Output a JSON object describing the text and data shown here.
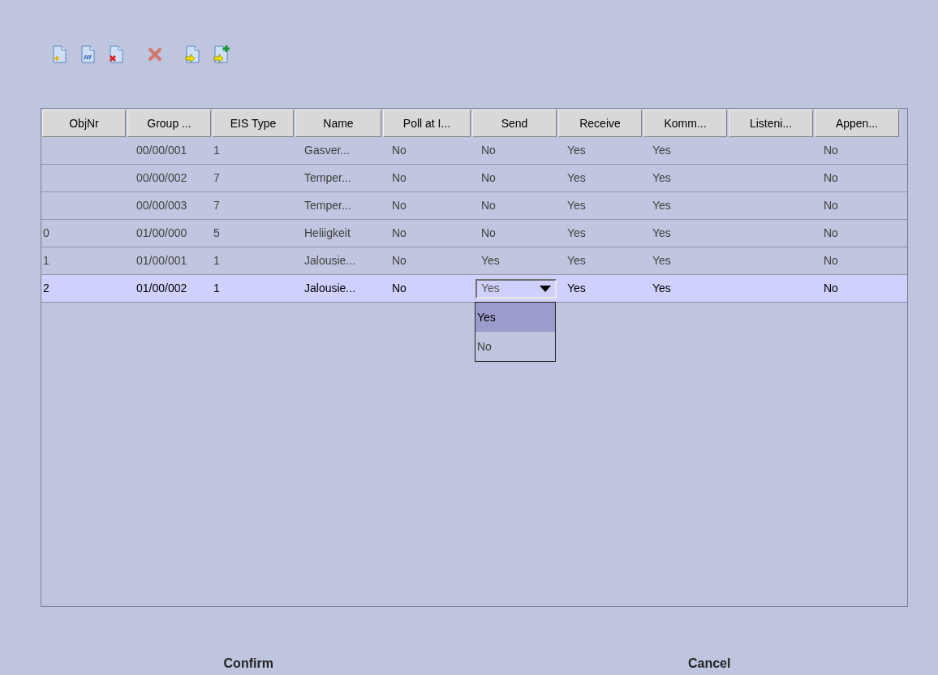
{
  "toolbar": [
    {
      "kind": "new"
    },
    {
      "kind": "edit"
    },
    {
      "kind": "delete-doc"
    },
    {
      "kind": "remove"
    },
    {
      "kind": "import"
    },
    {
      "kind": "import-add"
    }
  ],
  "table": {
    "columns": [
      "ObjNr",
      "Group ...",
      "EIS Type",
      "Name",
      "Poll at I...",
      "Send",
      "Receive",
      "Komm...",
      "Listeni...",
      "Appen..."
    ],
    "rows": [
      {
        "selected": false,
        "cells": [
          null,
          "00/00/001",
          "1",
          "Gasver...",
          "No",
          "No",
          "Yes",
          "Yes",
          null,
          "No"
        ]
      },
      {
        "selected": false,
        "cells": [
          null,
          "00/00/002",
          "7",
          "Temper...",
          "No",
          "No",
          "Yes",
          "Yes",
          null,
          "No"
        ]
      },
      {
        "selected": false,
        "cells": [
          null,
          "00/00/003",
          "7",
          "Temper...",
          "No",
          "No",
          "Yes",
          "Yes",
          null,
          "No"
        ]
      },
      {
        "selected": false,
        "cells": [
          "0",
          "01/00/000",
          "5",
          "Heliigkeit",
          "No",
          "No",
          "Yes",
          "Yes",
          null,
          "No"
        ]
      },
      {
        "selected": false,
        "cells": [
          "1",
          "01/00/001",
          "1",
          "Jalousie...",
          "No",
          "Yes",
          "Yes",
          "Yes",
          null,
          "No"
        ]
      },
      {
        "selected": true,
        "cells": [
          "2",
          "01/00/002",
          "1",
          "Jalousie...",
          "No",
          {
            "kind": "dropdown",
            "value": "Yes",
            "options": [
              {
                "label": "Yes",
                "selected": true
              },
              {
                "label": "No",
                "selected": false
              }
            ]
          },
          "Yes",
          "Yes",
          null,
          "No"
        ]
      }
    ]
  },
  "buttons": [
    "Confirm",
    "Cancel"
  ]
}
